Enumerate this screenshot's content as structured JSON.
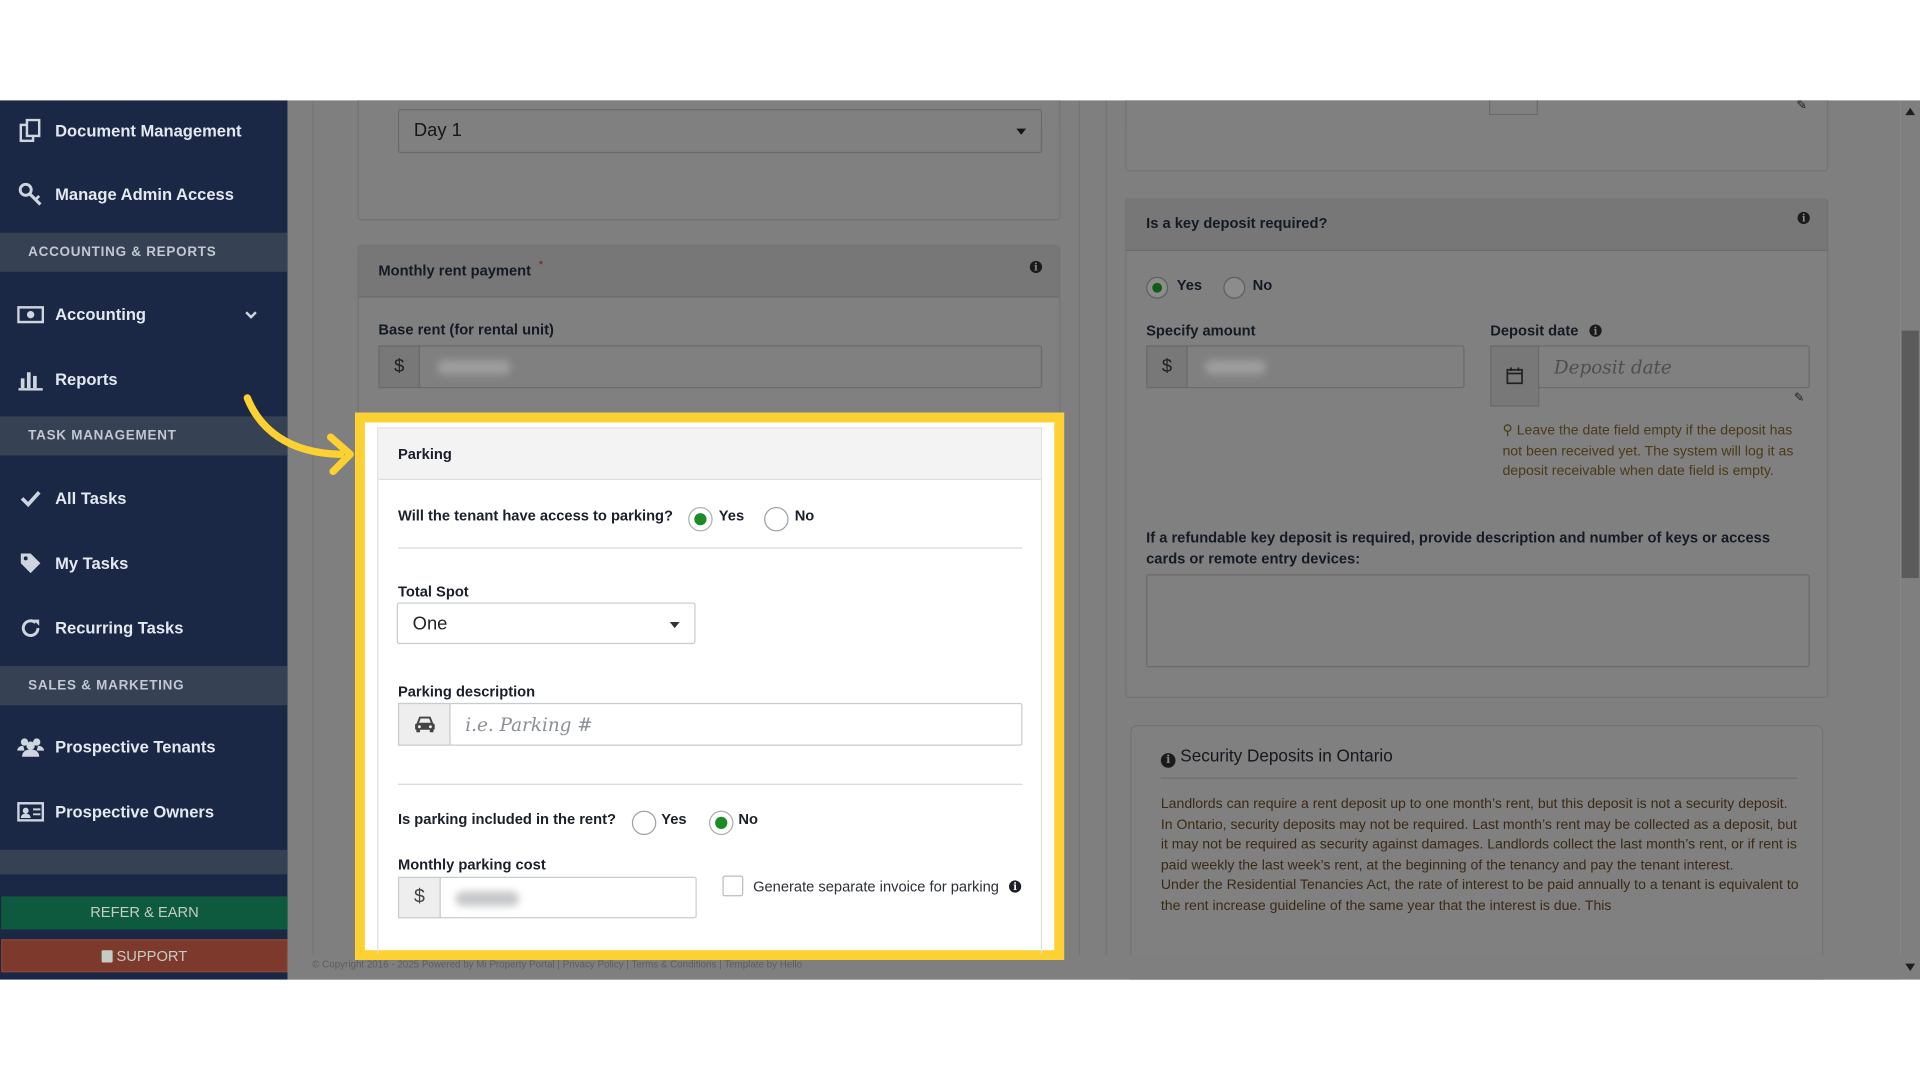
{
  "sidebar": {
    "items_top": [
      {
        "label": "Document Management",
        "icon": "document-icon"
      },
      {
        "label": "Manage Admin Access",
        "icon": "key-icon"
      }
    ],
    "section_accounting": "ACCOUNTING & REPORTS",
    "accounting_label": "Accounting",
    "reports_label": "Reports",
    "section_tasks": "TASK MANAGEMENT",
    "all_tasks_label": "All Tasks",
    "my_tasks_label": "My Tasks",
    "recurring_tasks_label": "Recurring Tasks",
    "section_sales": "SALES & MARKETING",
    "prospective_tenants_label": "Prospective Tenants",
    "prospective_owners_label": "Prospective Owners",
    "refer_label": "REFER & EARN",
    "support_label": "SUPPORT"
  },
  "left_column": {
    "day_select_value": "Day 1",
    "monthly_rent_title": "Monthly rent payment",
    "required_mark": "*",
    "base_rent_label": "Base rent (for rental unit)",
    "currency": "$"
  },
  "parking": {
    "title": "Parking",
    "access_question": "Will the tenant have access to parking?",
    "yes": "Yes",
    "no": "No",
    "access_value": "Yes",
    "total_spot_label": "Total Spot",
    "total_spot_value": "One",
    "description_label": "Parking description",
    "description_placeholder": "i.e. Parking #",
    "included_question": "Is parking included in the rent?",
    "included_value": "No",
    "monthly_cost_label": "Monthly parking cost",
    "currency": "$",
    "invoice_label": "Generate separate invoice for parking"
  },
  "right_column": {
    "key_deposit_title": "Is a key deposit required?",
    "yes": "Yes",
    "no": "No",
    "key_deposit_value": "Yes",
    "specify_amount_label": "Specify amount",
    "deposit_date_label": "Deposit date",
    "deposit_date_placeholder": "Deposit date",
    "currency": "$",
    "date_hint": "Leave the date field empty if the deposit has not been received yet. The system will log it as deposit receivable when date field is empty.",
    "refundable_label": "If a refundable key deposit is required, provide description and number of keys or access cards or remote entry devices:",
    "security_title": "Security Deposits in Ontario",
    "security_p1": "Landlords can require a rent deposit up to one month’s rent, but this deposit is not a security deposit. In Ontario, security deposits may not be required. Last month’s rent may be collected as a deposit, but it may not be required as security against damages. Landlords collect the last month’s rent, or if rent is paid weekly the last week’s rent, at the beginning of the tenancy and pay the tenant interest.",
    "security_p2": "Under the Residential Tenancies Act, the rate of interest to be paid annually to a tenant is equivalent to the rent increase guideline of the same year that the interest is due. This"
  },
  "footer": {
    "text": "© Copyright 2016 - 2025 Powered by Mi Property Portal | Privacy Policy | Terms & Conditions | Template by Hello"
  },
  "colors": {
    "sidebar_bg": "#1a2845",
    "highlight_border": "#fdd132",
    "arrow": "#fdd132",
    "radio_selected": "#1d8b25",
    "refer_button": "#0d7a55",
    "support_button": "#b5432b"
  }
}
